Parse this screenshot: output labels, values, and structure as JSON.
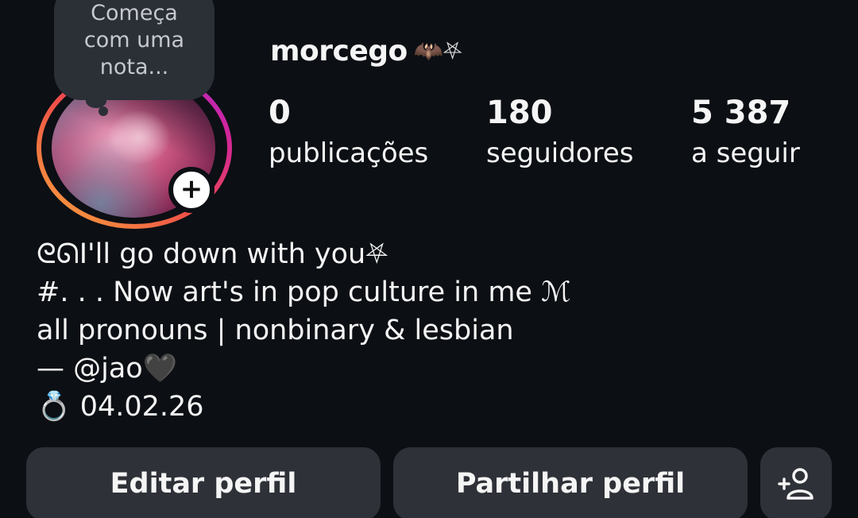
{
  "note": {
    "text_line1": "Começa",
    "text_line2": "com uma",
    "text_line3": "nota..."
  },
  "profile": {
    "username": "morcego",
    "username_decoration": "🦇⛧",
    "ring_colors": [
      "#f6a83b",
      "#ef4d48",
      "#d1249d",
      "#9a33d6"
    ]
  },
  "stats": {
    "posts": {
      "value": "0",
      "label": "publicações"
    },
    "followers": {
      "value": "180",
      "label": "seguidores"
    },
    "following": {
      "value": "5 387",
      "label": "a seguir"
    }
  },
  "bio": {
    "line1": "ᘓᘏI'll go down with you⛧",
    "line2": "#. . . Now art's in pop culture in me ℳ",
    "line3": "all pronouns | nonbinary & lesbian",
    "line4": "— @jao🖤",
    "line5": "💍 04.02.26"
  },
  "actions": {
    "edit_label": "Editar perfil",
    "share_label": "Partilhar perfil",
    "add_person_icon": "add-person-icon"
  }
}
